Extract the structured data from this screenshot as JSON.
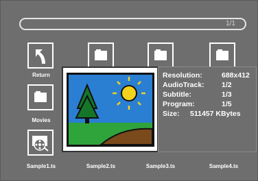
{
  "path_bar": {
    "page_indicator": "1/1"
  },
  "files": [
    {
      "name": "Return",
      "icon": "return-arrow-icon"
    },
    {
      "name": "Movies",
      "icon": "folder-icon"
    },
    {
      "name": "Sample1.ts",
      "icon": "film-reel-icon"
    },
    {
      "name": "Sample2.ts",
      "icon": "folder-icon"
    },
    {
      "name": "Sample3.ts",
      "icon": "folder-icon"
    },
    {
      "name": "Sample4.ts",
      "icon": "folder-icon"
    }
  ],
  "info_panel": {
    "resolution_label": "Resolution:",
    "resolution_value": "688x412",
    "audiotrack_label": "AudioTrack:",
    "audiotrack_value": "1/2",
    "subtitle_label": "Subtitle:",
    "subtitle_value": "1/3",
    "program_label": "Program:",
    "program_value": "1/5",
    "size_label": "Size:",
    "size_value": "511457 KBytes"
  },
  "colors": {
    "background": "#6e6e6e",
    "text": "#ffffff",
    "sky": "#2a7fd2",
    "grass": "#2fa43a",
    "sun": "#f2d21c",
    "hill": "#7a4a1c"
  }
}
